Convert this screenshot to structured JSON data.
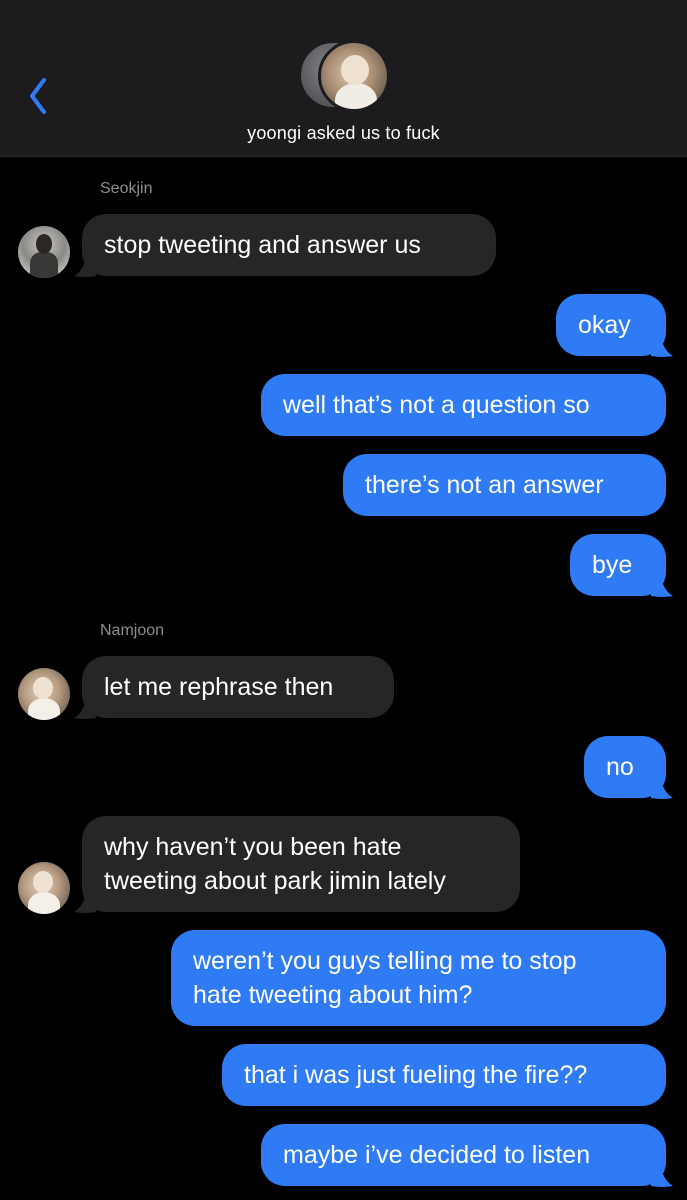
{
  "header": {
    "title": "yoongi asked us to fuck",
    "back_icon": "chevron-left-icon",
    "accent": "#2f7bf6"
  },
  "messages": [
    {
      "sender": "Seokjin",
      "direction": "incoming",
      "text": "stop tweeting and answer us"
    },
    {
      "direction": "outgoing",
      "text": "okay"
    },
    {
      "direction": "outgoing",
      "text": "well that’s not a question so"
    },
    {
      "direction": "outgoing",
      "text": "there’s not an answer"
    },
    {
      "direction": "outgoing",
      "text": "bye"
    },
    {
      "sender": "Namjoon",
      "direction": "incoming",
      "text": "let me rephrase then"
    },
    {
      "direction": "outgoing",
      "text": "no"
    },
    {
      "sender": "Namjoon",
      "direction": "incoming",
      "lines": [
        "why haven’t you been hate",
        "tweeting about park jimin lately"
      ]
    },
    {
      "direction": "outgoing",
      "lines": [
        "weren’t you guys telling me to stop",
        "hate tweeting about him?"
      ]
    },
    {
      "direction": "outgoing",
      "text": "that i was just fueling the fire??"
    },
    {
      "direction": "outgoing",
      "text": "maybe i’ve decided to listen"
    }
  ],
  "colors": {
    "incoming_bubble": "#262628",
    "outgoing_bubble": "#2f7bf6",
    "header_bg": "#1c1c1e",
    "sender_label": "#8e8e93"
  }
}
